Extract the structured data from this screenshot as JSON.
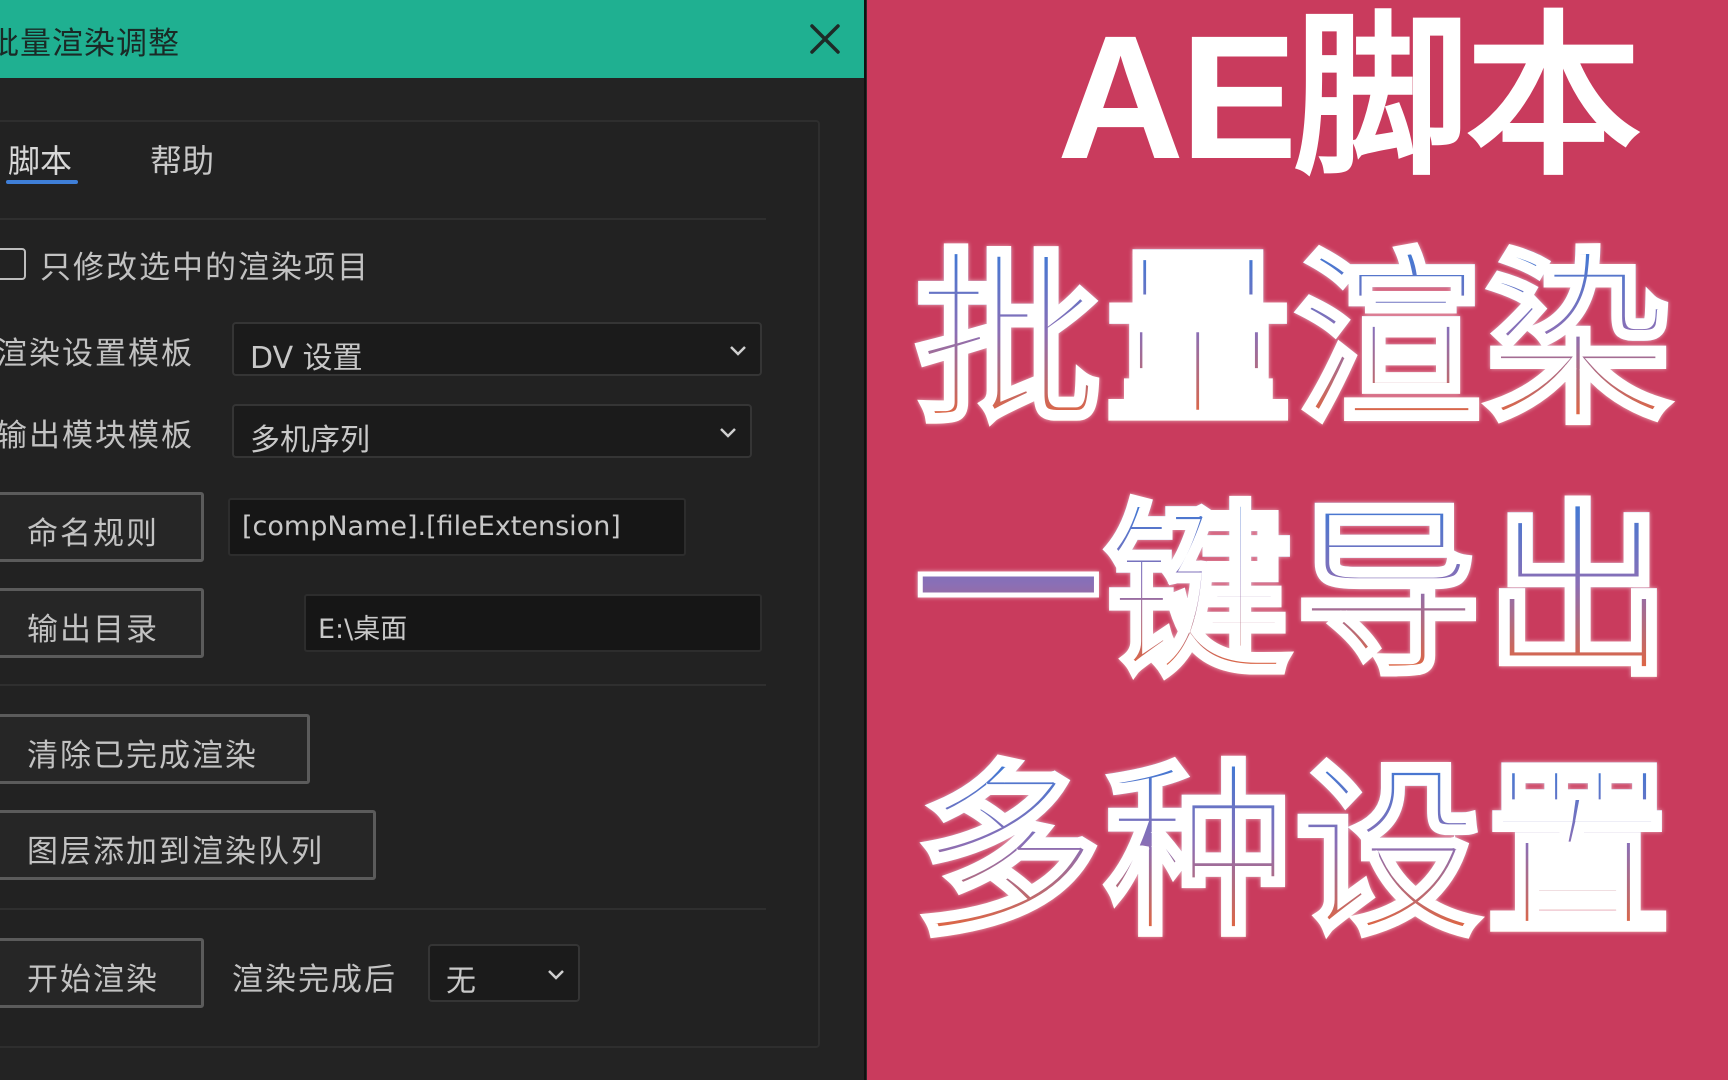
{
  "dialog": {
    "title": "批量渲染调整",
    "tabs": [
      "脚本",
      "帮助"
    ],
    "checkbox_label": "只修改选中的渲染项目",
    "render_template_label": "渲染设置模板",
    "render_template_value": "DV 设置",
    "output_module_label": "输出模块模板",
    "output_module_value": "多机序列",
    "naming_rule_button": "命名规则",
    "naming_rule_value": "[compName].[fileExtension]",
    "output_dir_button": "输出目录",
    "output_dir_value": "E:\\桌面",
    "clear_button": "清除已完成渲染",
    "add_layers_button": "图层添加到渲染队列",
    "start_button": "开始渲染",
    "after_render_label": "渲染完成后",
    "after_render_value": "无"
  },
  "promo": {
    "title": "AE脚本",
    "line1": "批量渲染",
    "line2": "一键导出",
    "line3": "多种设置"
  },
  "colors": {
    "titlebar": "#1fb091",
    "promo_bg": "#c93b5d",
    "accent": "#3f7fd8"
  },
  "icons": [
    "close-icon",
    "chevron-down-icon",
    "checkbox"
  ]
}
